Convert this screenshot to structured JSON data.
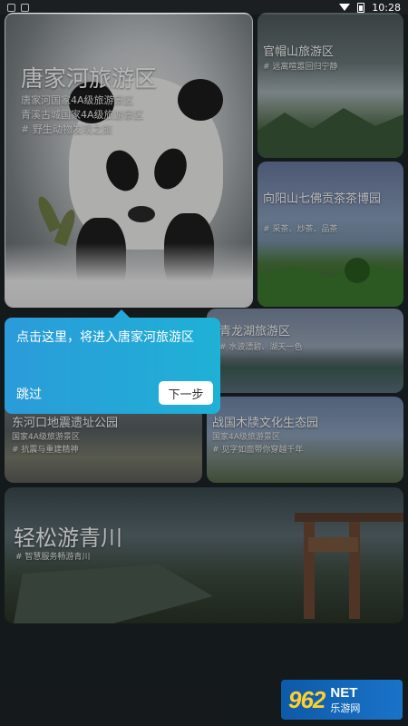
{
  "status_bar": {
    "time": "10:28"
  },
  "cards": [
    {
      "id": "tangjiahe",
      "title": "唐家河旅游区",
      "lines": [
        "唐家河国家4A级旅游景区",
        "青溪古城国家4A级旅游景区",
        "# 野生动物发现之旅"
      ]
    },
    {
      "id": "guanmaoshan",
      "title": "官帽山旅游区",
      "lines": [
        "# 远离喧嚣回归宁静"
      ]
    },
    {
      "id": "xiangyangshan",
      "title": "向阳山七佛贡茶茶博园",
      "lines": [
        "# 采茶、炒茶、品茶"
      ]
    },
    {
      "id": "qinglonghu",
      "title": "青龙湖旅游区",
      "lines": [
        "# 水波漂碧、湖天一色"
      ]
    },
    {
      "id": "donghekou",
      "title": "东河口地震遗址公园",
      "lines": [
        "国家4A级旅游景区",
        "# 抗震与重建精神"
      ]
    },
    {
      "id": "zhanguo",
      "title": "战国木牍文化生态园",
      "lines": [
        "国家4A级旅游景区",
        "# 见字如面带你穿越千年"
      ]
    },
    {
      "id": "qingchuan",
      "title": "轻松游青川",
      "lines": [
        "# 智慧服务畅游青川"
      ]
    }
  ],
  "guide": {
    "text": "点击这里，将进入唐家河旅游区",
    "skip_label": "跳过",
    "next_label": "下一步"
  },
  "watermark": {
    "number": "962",
    "net": "NET",
    "chinese": "乐游网"
  },
  "colors": {
    "tooltip": "#25a6d8",
    "watermark_bg": "#1368b8",
    "watermark_number": "#ffcf2e"
  }
}
